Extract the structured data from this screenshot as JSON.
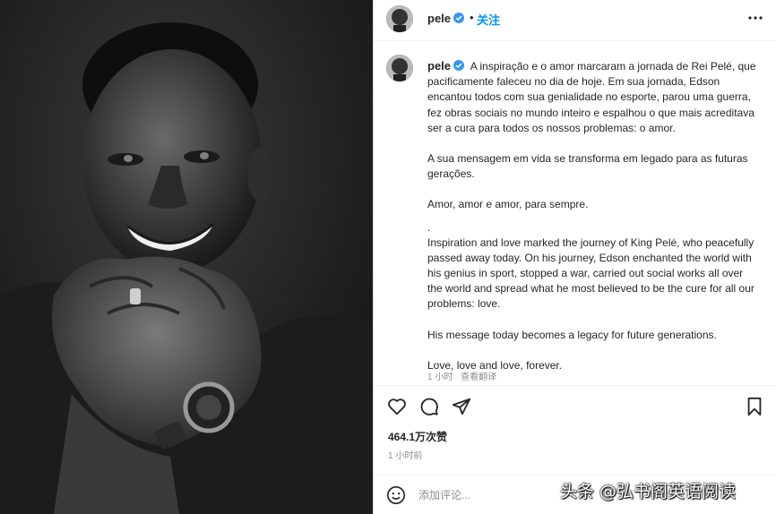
{
  "post": {
    "username": "pele",
    "follow_label": "关注",
    "separator": "•",
    "caption_paragraphs": [
      "A inspiração e o amor marcaram a jornada de Rei Pelé, que pacificamente faleceu no dia de hoje. Em sua jornada, Edson encantou todos com sua genialidade no esporte, parou uma guerra, fez obras sociais no mundo inteiro e espalhou o que mais acreditava ser a cura para todos os nossos problemas: o amor.",
      "A sua mensagem em vida se transforma em legado para as futuras gerações.",
      "Amor, amor e amor, para sempre.",
      ".",
      "Inspiration and love marked the journey of King Pelé, who peacefully passed away today. On his journey, Edson enchanted the world with his genius in sport, stopped a war, carried out social works all over the world and spread what he most believed to be the cure for all our problems: love.",
      "His message today becomes a legacy for future generations.",
      "Love, love and love, forever."
    ],
    "caption_time": "1 小时",
    "translate_label": "查看翻译",
    "likes": "464.1万次赞",
    "posted_time": "1 小时前",
    "comment_placeholder": "添加评论..."
  },
  "watermark": "头条 @弘书阁英语阅读",
  "icons": {
    "verified": "verified-badge-icon",
    "more": "more-options-icon",
    "like": "heart-icon",
    "comment": "comment-bubble-icon",
    "share": "paper-plane-icon",
    "save": "bookmark-icon",
    "emoji": "smiley-icon"
  },
  "colors": {
    "link_blue": "#0095f6",
    "verified_blue": "#3897f0",
    "text": "#262626",
    "secondary_text": "#8e8e8e"
  }
}
